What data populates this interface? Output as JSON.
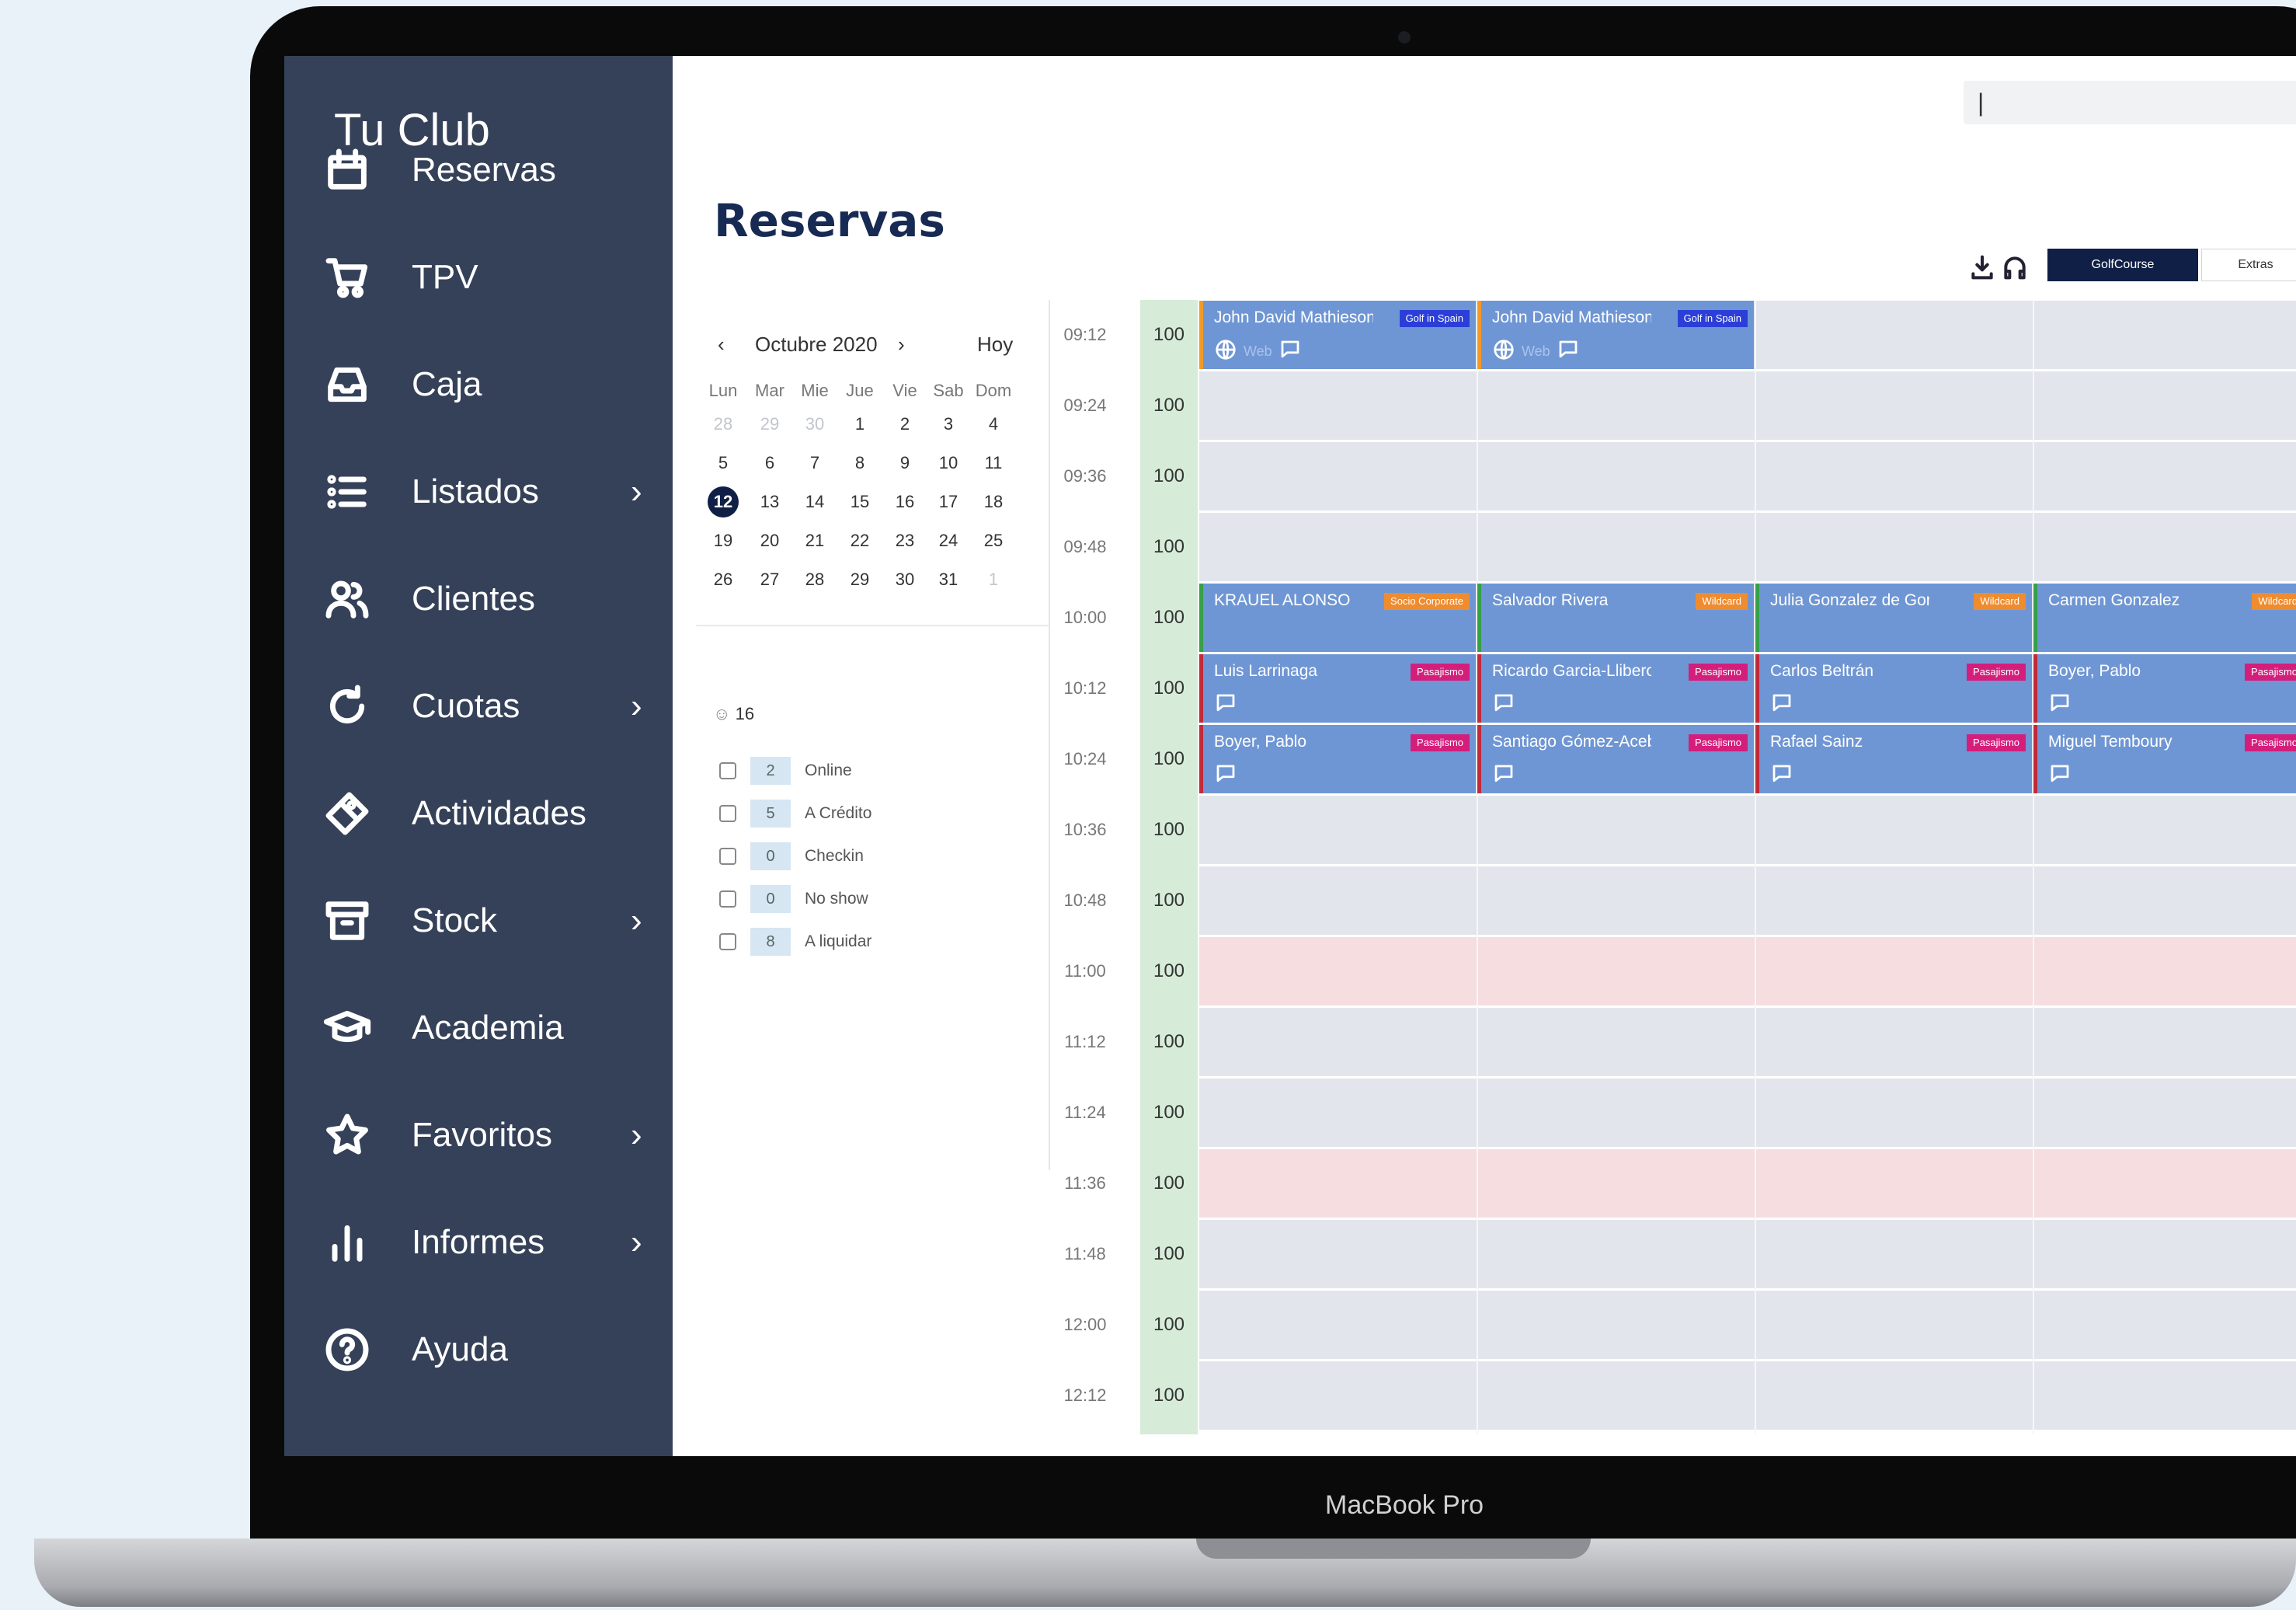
{
  "app": {
    "club_name": "Tu Club",
    "page_title": "Reservas",
    "search_value": "|"
  },
  "sidebar": {
    "items": [
      {
        "label": "Reservas",
        "icon": "calendar-icon",
        "chevron": false
      },
      {
        "label": "TPV",
        "icon": "cart-icon",
        "chevron": false
      },
      {
        "label": "Caja",
        "icon": "inbox-icon",
        "chevron": false
      },
      {
        "label": "Listados",
        "icon": "list-icon",
        "chevron": true
      },
      {
        "label": "Clientes",
        "icon": "users-icon",
        "chevron": false
      },
      {
        "label": "Cuotas",
        "icon": "refresh-icon",
        "chevron": true
      },
      {
        "label": "Actividades",
        "icon": "ticket-icon",
        "chevron": false
      },
      {
        "label": "Stock",
        "icon": "archive-icon",
        "chevron": true
      },
      {
        "label": "Academia",
        "icon": "graduation-cap-icon",
        "chevron": false
      },
      {
        "label": "Favoritos",
        "icon": "star-icon",
        "chevron": true
      },
      {
        "label": "Informes",
        "icon": "bar-chart-icon",
        "chevron": true
      },
      {
        "label": "Ayuda",
        "icon": "help-icon",
        "chevron": false
      }
    ],
    "chevron_glyph": "›"
  },
  "toolbar": {
    "views": [
      "GolfCourse",
      "Extras"
    ],
    "icons": [
      "download-icon",
      "headset-icon"
    ]
  },
  "calendar": {
    "prev": "‹",
    "next": "›",
    "month_label": "Octubre 2020",
    "today_label": "Hoy",
    "weekdays": [
      "Lun",
      "Mar",
      "Mie",
      "Jue",
      "Vie",
      "Sab",
      "Dom"
    ],
    "weeks": [
      [
        [
          "28",
          true
        ],
        [
          "29",
          true
        ],
        [
          "30",
          true
        ],
        [
          "1",
          false
        ],
        [
          "2",
          false
        ],
        [
          "3",
          false
        ],
        [
          "4",
          false
        ]
      ],
      [
        [
          "5",
          false
        ],
        [
          "6",
          false
        ],
        [
          "7",
          false
        ],
        [
          "8",
          false
        ],
        [
          "9",
          false
        ],
        [
          "10",
          false
        ],
        [
          "11",
          false
        ]
      ],
      [
        [
          "12",
          false
        ],
        [
          "13",
          false
        ],
        [
          "14",
          false
        ],
        [
          "15",
          false
        ],
        [
          "16",
          false
        ],
        [
          "17",
          false
        ],
        [
          "18",
          false
        ]
      ],
      [
        [
          "19",
          false
        ],
        [
          "20",
          false
        ],
        [
          "21",
          false
        ],
        [
          "22",
          false
        ],
        [
          "23",
          false
        ],
        [
          "24",
          false
        ],
        [
          "25",
          false
        ]
      ],
      [
        [
          "26",
          false
        ],
        [
          "27",
          false
        ],
        [
          "28",
          false
        ],
        [
          "29",
          false
        ],
        [
          "30",
          false
        ],
        [
          "31",
          false
        ],
        [
          "1",
          true
        ]
      ]
    ],
    "selected_day": "12"
  },
  "summary": {
    "players_count": "16",
    "filters": [
      {
        "count": "2",
        "label": "Online"
      },
      {
        "count": "5",
        "label": "A Crédito"
      },
      {
        "count": "0",
        "label": "Checkin"
      },
      {
        "count": "0",
        "label": "No show"
      },
      {
        "count": "8",
        "label": "A liquidar"
      }
    ]
  },
  "schedule": {
    "times": [
      "09:12",
      "09:24",
      "09:36",
      "09:48",
      "10:00",
      "10:12",
      "10:24",
      "10:36",
      "10:48",
      "11:00",
      "11:12",
      "11:24",
      "11:36",
      "11:48",
      "12:00",
      "12:12"
    ],
    "capacity": "100",
    "blocked_rows": [
      9,
      12
    ],
    "web_label": "Web",
    "bookings": [
      {
        "row": 0,
        "col": 0,
        "name": "John David Mathieson",
        "tag": "Golf in Spain",
        "tag_color": "blue",
        "border": "orange",
        "icons": [
          "globe-icon",
          "comment-icon"
        ]
      },
      {
        "row": 0,
        "col": 1,
        "name": "John David Mathieson",
        "tag": "Golf in Spain",
        "tag_color": "blue",
        "border": "orange",
        "icons": [
          "globe-icon",
          "comment-icon"
        ]
      },
      {
        "row": 4,
        "col": 0,
        "name": "KRAUEL ALONSO",
        "tag": "Socio Corporate",
        "tag_color": "orange",
        "border": "green",
        "icons": []
      },
      {
        "row": 4,
        "col": 1,
        "name": "Salvador Rivera",
        "tag": "Wildcard",
        "tag_color": "orange",
        "border": "green",
        "icons": []
      },
      {
        "row": 4,
        "col": 2,
        "name": "Julia Gonzalez de Gor",
        "tag": "Wildcard",
        "tag_color": "orange",
        "border": "green",
        "icons": []
      },
      {
        "row": 4,
        "col": 3,
        "name": "Carmen Gonzalez",
        "tag": "Wildcard",
        "tag_color": "orange",
        "border": "green",
        "icons": []
      },
      {
        "row": 5,
        "col": 0,
        "name": "Luis Larrinaga",
        "tag": "Pasajismo",
        "tag_color": "pink",
        "border": "red",
        "icons": [
          "comment-icon"
        ]
      },
      {
        "row": 5,
        "col": 1,
        "name": "Ricardo Garcia-Lliberos",
        "tag": "Pasajismo",
        "tag_color": "pink",
        "border": "red",
        "icons": [
          "comment-icon"
        ]
      },
      {
        "row": 5,
        "col": 2,
        "name": "Carlos Beltrán",
        "tag": "Pasajismo",
        "tag_color": "pink",
        "border": "red",
        "icons": [
          "comment-icon"
        ]
      },
      {
        "row": 5,
        "col": 3,
        "name": "Boyer, Pablo",
        "tag": "Pasajismo",
        "tag_color": "pink",
        "border": "red",
        "icons": [
          "comment-icon"
        ]
      },
      {
        "row": 6,
        "col": 0,
        "name": "Boyer, Pablo",
        "tag": "Pasajismo",
        "tag_color": "pink",
        "border": "red",
        "icons": [
          "comment-icon"
        ]
      },
      {
        "row": 6,
        "col": 1,
        "name": "Santiago Gómez-Acebo",
        "tag": "Pasajismo",
        "tag_color": "pink",
        "border": "red",
        "icons": [
          "comment-icon"
        ]
      },
      {
        "row": 6,
        "col": 2,
        "name": "Rafael Sainz",
        "tag": "Pasajismo",
        "tag_color": "pink",
        "border": "red",
        "icons": [
          "comment-icon"
        ]
      },
      {
        "row": 6,
        "col": 3,
        "name": "Miguel Temboury",
        "tag": "Pasajismo",
        "tag_color": "pink",
        "border": "red",
        "icons": [
          "comment-icon"
        ]
      }
    ]
  },
  "device": {
    "label": "MacBook Pro"
  }
}
